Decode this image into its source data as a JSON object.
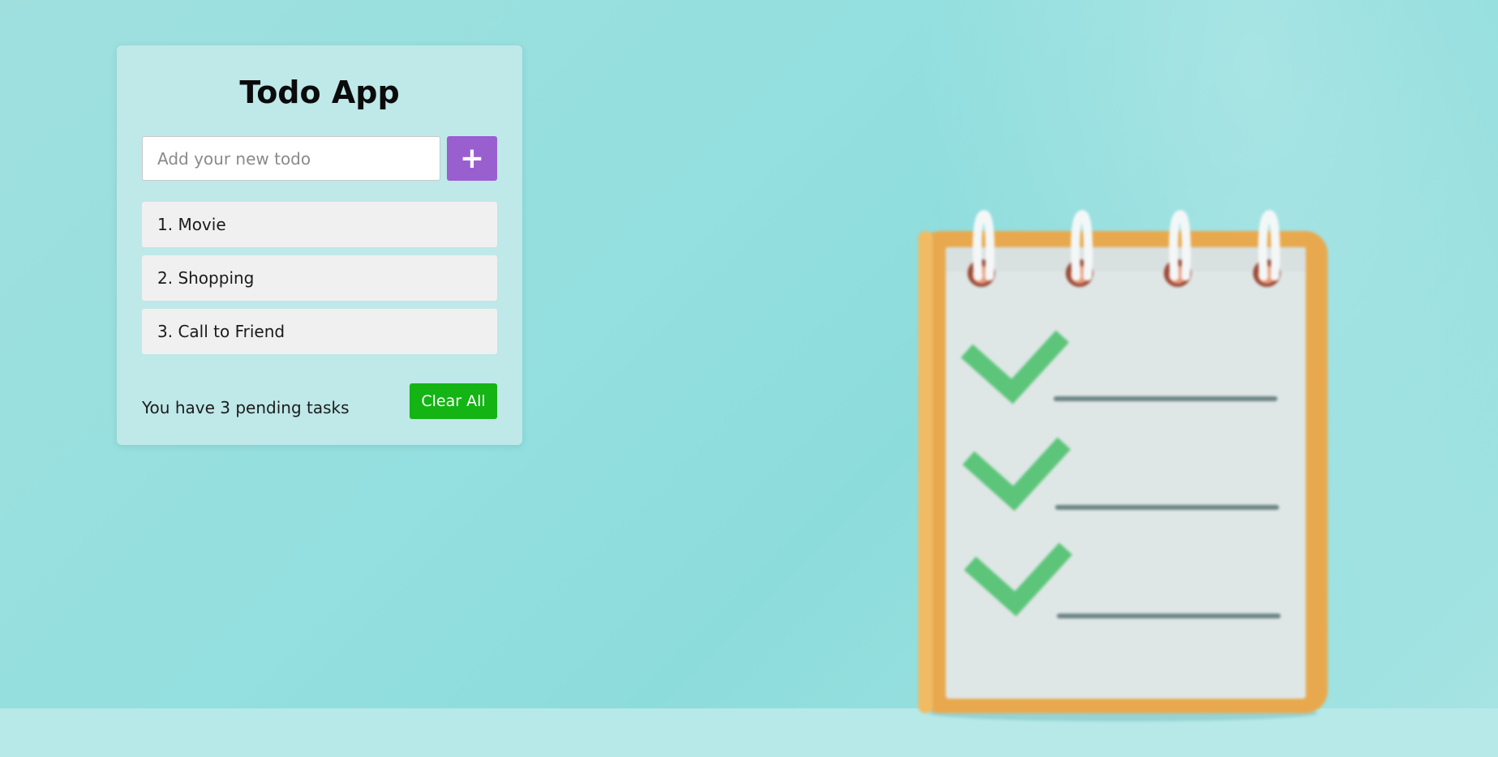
{
  "app": {
    "title": "Todo App"
  },
  "input": {
    "placeholder": "Add your new todo",
    "value": ""
  },
  "add_button": {
    "label": "+"
  },
  "todos": [
    {
      "label": "1. Movie"
    },
    {
      "label": "2. Shopping"
    },
    {
      "label": "3. Call to Friend"
    }
  ],
  "footer": {
    "pending_text": "You have 3 pending tasks",
    "clear_label": "Clear All"
  },
  "colors": {
    "add_button": "#9a5fcf",
    "clear_button": "#13b413",
    "card": "#bfe8e8",
    "background": "#94dfdf"
  },
  "illustration": {
    "icon": "notepad-checklist-icon"
  }
}
